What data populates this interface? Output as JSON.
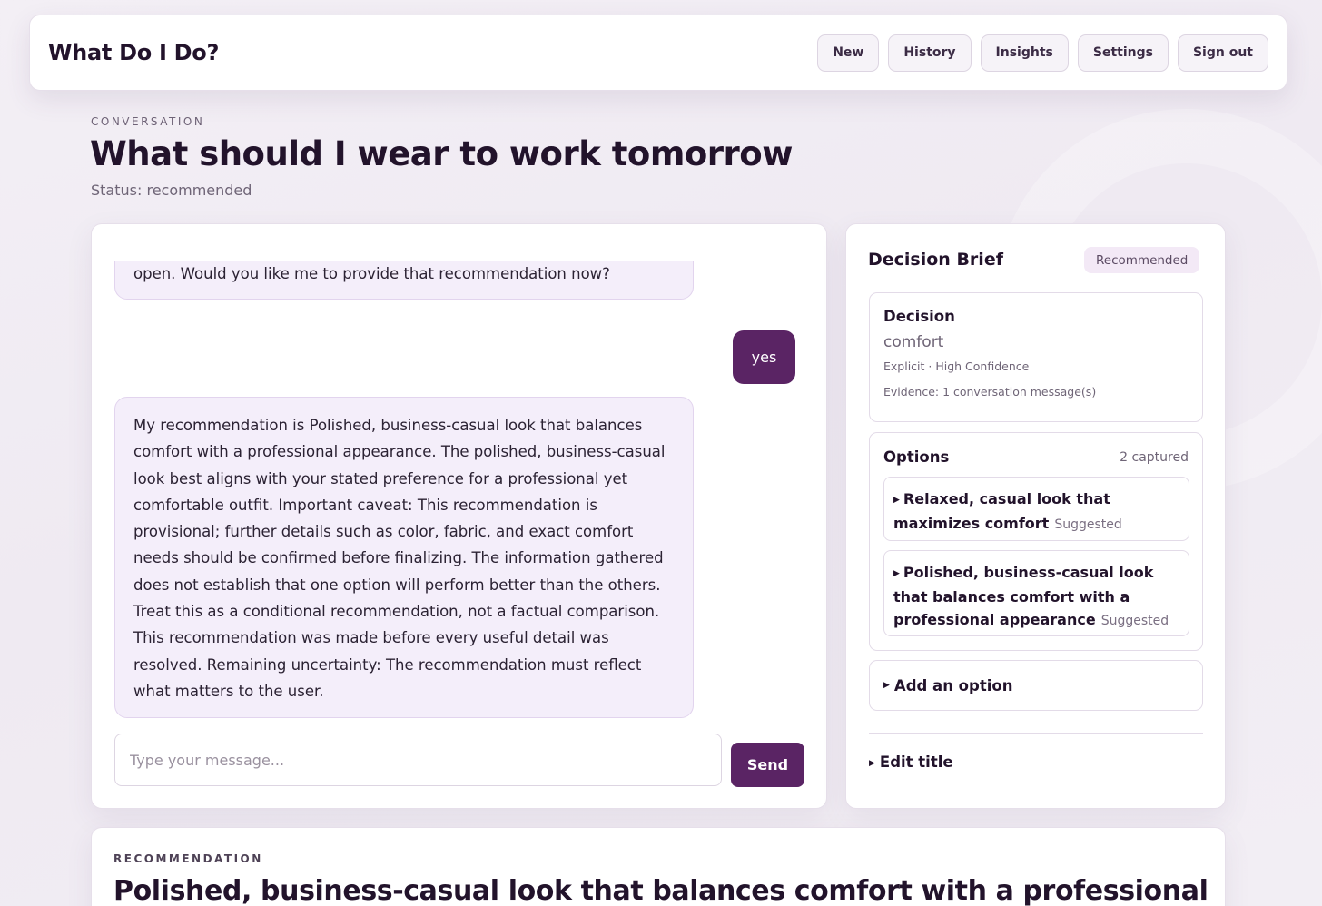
{
  "app": {
    "title": "What Do I Do?"
  },
  "nav": {
    "new": "New",
    "history": "History",
    "insights": "Insights",
    "settings": "Settings",
    "signout": "Sign out"
  },
  "page": {
    "eyebrow": "CONVERSATION",
    "title": "What should I wear to work tomorrow",
    "status": "Status: recommended"
  },
  "chat": {
    "messages": [
      {
        "role": "assistant",
        "text": "your outfit, though some specific details like color preferences remain open. Would you like me to provide that recommendation now?"
      },
      {
        "role": "user",
        "text": "yes"
      },
      {
        "role": "assistant",
        "text": "My recommendation is Polished, business-casual look that balances comfort with a professional appearance. The polished, business-casual look best aligns with your stated preference for a professional yet comfortable outfit. Important caveat: This recommendation is provisional; further details such as color, fabric, and exact comfort needs should be confirmed before finalizing. The information gathered does not establish that one option will perform better than the others. Treat this as a conditional recommendation, not a factual comparison. This recommendation was made before every useful detail was resolved. Remaining uncertainty: The recommendation must reflect what matters to the user."
      }
    ],
    "input": {
      "value": "",
      "placeholder": "Type your message..."
    },
    "send_label": "Send"
  },
  "brief": {
    "title": "Decision Brief",
    "badge": "Recommended",
    "decision": {
      "heading": "Decision",
      "value": "comfort",
      "meta": "Explicit · High Confidence",
      "evidence": "Evidence: 1 conversation message(s)"
    },
    "options": {
      "heading": "Options",
      "count": "2 captured",
      "items": [
        {
          "label": "Relaxed, casual look that maximizes comfort",
          "tag": "Suggested"
        },
        {
          "label": "Polished, business-casual look that balances comfort with a professional appearance",
          "tag": "Suggested"
        }
      ]
    },
    "add_option": "Add an option",
    "edit_title": "Edit title"
  },
  "recommendation": {
    "eyebrow": "RECOMMENDATION",
    "title": "Polished, business-casual look that balances comfort with a professional"
  },
  "colors": {
    "accent": "#5a2464",
    "bubble": "#f4eefa",
    "background": "#f1ecf4"
  }
}
